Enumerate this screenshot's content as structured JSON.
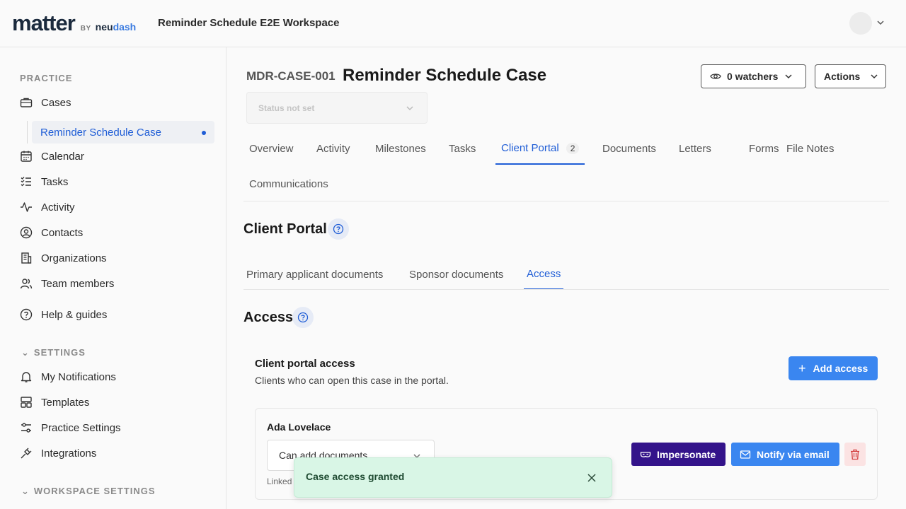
{
  "header": {
    "logo_main": "matter",
    "logo_by": "BY",
    "logo_neu": "neu",
    "logo_dash": "dash",
    "workspace_title": "Reminder Schedule E2E Workspace"
  },
  "sidebar": {
    "practice_label": "PRACTICE",
    "items": [
      {
        "label": "Cases",
        "icon": "briefcase-icon"
      },
      {
        "label": "Calendar",
        "icon": "calendar-icon"
      },
      {
        "label": "Tasks",
        "icon": "tasks-icon"
      },
      {
        "label": "Activity",
        "icon": "activity-icon"
      },
      {
        "label": "Contacts",
        "icon": "contacts-icon"
      },
      {
        "label": "Organizations",
        "icon": "building-icon"
      },
      {
        "label": "Team members",
        "icon": "team-icon"
      },
      {
        "label": "Help & guides",
        "icon": "help-icon"
      }
    ],
    "active_sub": "Reminder Schedule Case",
    "settings_label": "SETTINGS",
    "settings_items": [
      {
        "label": "My Notifications",
        "icon": "bell-icon"
      },
      {
        "label": "Templates",
        "icon": "templates-icon"
      },
      {
        "label": "Practice Settings",
        "icon": "sliders-icon"
      },
      {
        "label": "Integrations",
        "icon": "plug-icon"
      }
    ],
    "workspace_settings_label": "WORKSPACE SETTINGS"
  },
  "case": {
    "id": "MDR-CASE-001",
    "title": "Reminder Schedule Case",
    "watchers_label": "0 watchers",
    "actions_label": "Actions",
    "status_placeholder": "Status not set"
  },
  "tabs": [
    {
      "label": "Overview"
    },
    {
      "label": "Activity"
    },
    {
      "label": "Milestones"
    },
    {
      "label": "Tasks"
    },
    {
      "label": "Client Portal",
      "badge": "2"
    },
    {
      "label": "Documents"
    },
    {
      "label": "Letters"
    },
    {
      "label": "Forms"
    },
    {
      "label": "File Notes"
    },
    {
      "label": "Communications"
    }
  ],
  "portal": {
    "heading": "Client Portal",
    "subtabs": [
      "Primary applicant documents",
      "Sponsor documents",
      "Access"
    ],
    "access_heading": "Access",
    "card_title": "Client portal access",
    "card_desc": "Clients who can open this case in the portal.",
    "add_access_label": "Add access",
    "person_name": "Ada Lovelace",
    "permission_value": "Can add documents",
    "linked_text": "Linked",
    "impersonate_label": "Impersonate",
    "notify_label": "Notify via email"
  },
  "toast": {
    "message": "Case access granted"
  },
  "colors": {
    "accent": "#1f5dd6",
    "primary_button": "#3a86f0",
    "impersonate": "#33138a",
    "toast_bg": "#d9f6e6"
  }
}
